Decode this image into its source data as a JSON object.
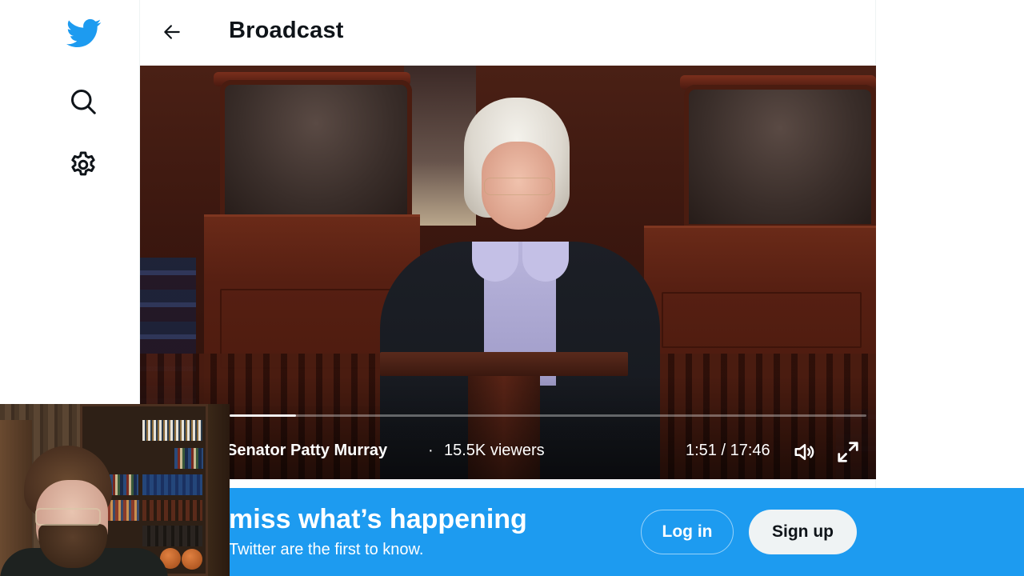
{
  "nav": {
    "items": [
      {
        "name": "twitter-logo",
        "icon": "twitter-bird-icon",
        "color": "#1d9bf0"
      },
      {
        "name": "explore",
        "icon": "search-icon"
      },
      {
        "name": "settings",
        "icon": "gear-icon"
      }
    ]
  },
  "header": {
    "back_icon": "arrow-left-icon",
    "title": "Broadcast"
  },
  "video": {
    "host": "Senator Patty Murray",
    "separator": "·",
    "viewers": "15.5K viewers",
    "time_display": "1:51 / 17:46",
    "current_time": "1:51",
    "duration": "17:46",
    "progress_fraction": 0.104,
    "volume_icon": "speaker-volume-icon",
    "fullscreen_icon": "expand-fullscreen-icon"
  },
  "banner": {
    "title": "Don’t miss what’s happening",
    "visible_title": "miss what’s happening",
    "subtitle": "People on Twitter are the first to know.",
    "visible_subtitle": "Twitter are the first to know.",
    "login_label": "Log in",
    "signup_label": "Sign up",
    "background_color": "#1d9bf0"
  },
  "webcam": {
    "label": "webcam-overlay"
  }
}
